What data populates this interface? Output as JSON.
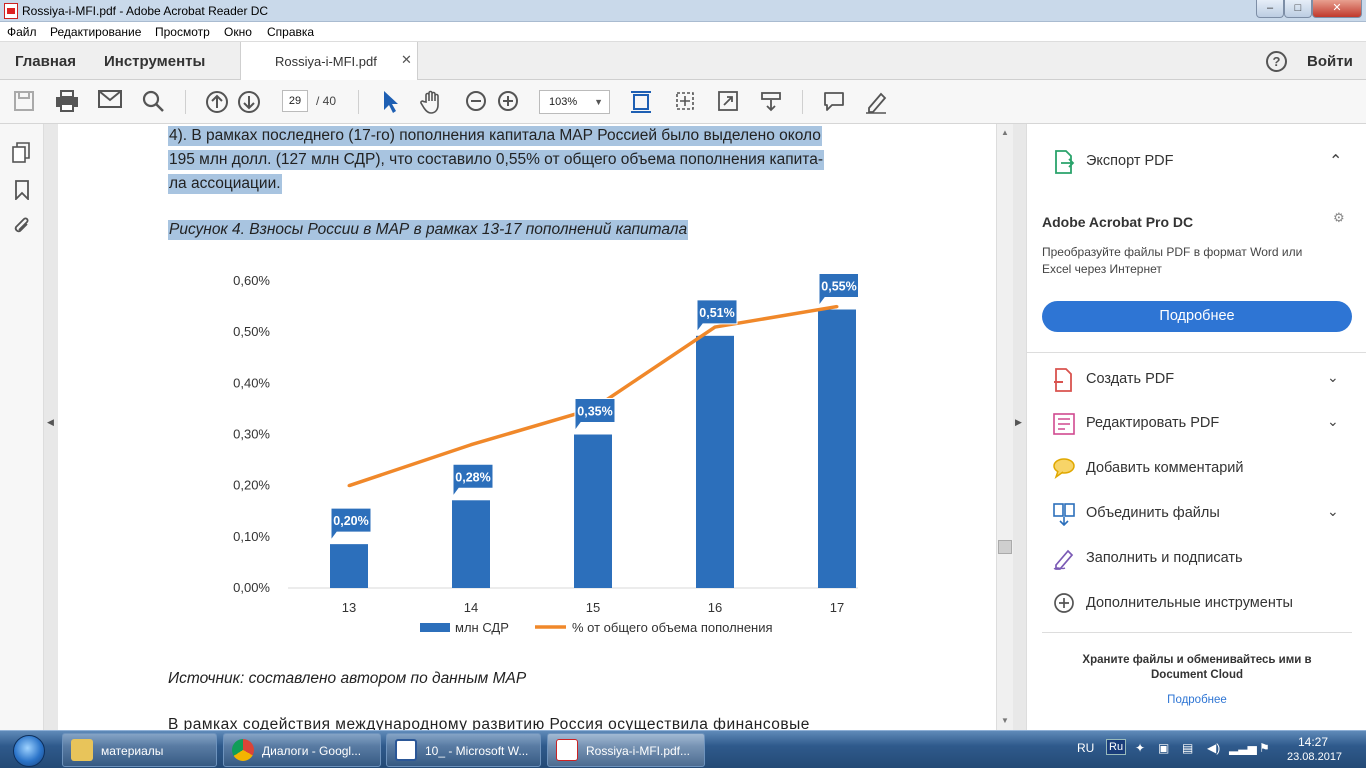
{
  "window": {
    "title": "Rossiya-i-MFI.pdf - Adobe Acrobat Reader DC",
    "min": "–",
    "max": "□",
    "close": "✕"
  },
  "menu": [
    "Файл",
    "Редактирование",
    "Просмотр",
    "Окно",
    "Справка"
  ],
  "tabs": {
    "home": "Главная",
    "tools": "Инструменты",
    "doc": "Rossiya-i-MFI.pdf",
    "close": "✕",
    "help": "?",
    "signin": "Войти"
  },
  "toolbar": {
    "page_current": "29",
    "page_total": "/ 40",
    "zoom": "103%"
  },
  "document": {
    "para_lines": [
      "4). В рамках последнего (17-го) пополнения капитала МАР Россией было выделено около",
      "195 млн долл. (127 млн СДР), что составило 0,55% от общего объема пополнения капита-",
      "ла ассоциации."
    ],
    "figure_caption": "Рисунок 4. Взносы России в МАР в рамках 13-17 пополнений капитала",
    "source": "Источник: составлено автором по данным МАР",
    "next_para": "В рамках содействия международному развитию Россия осуществила финансовые"
  },
  "chart_data": {
    "type": "bar",
    "categories": [
      "13",
      "14",
      "15",
      "16",
      "17"
    ],
    "series": [
      {
        "name": "млн СДР",
        "kind": "bar",
        "axis": "right",
        "color": "#2c6fbb",
        "values": [
          20,
          40,
          70,
          115,
          127
        ]
      },
      {
        "name": "% от общего объема пополнения",
        "kind": "line",
        "axis": "left",
        "color": "#f0882a",
        "values": [
          0.2,
          0.28,
          0.35,
          0.51,
          0.55
        ]
      }
    ],
    "data_labels": [
      "0,20%",
      "0,28%",
      "0,35%",
      "0,51%",
      "0,55%"
    ],
    "y_left": {
      "ticks": [
        "0,00%",
        "0,10%",
        "0,20%",
        "0,30%",
        "0,40%",
        "0,50%",
        "0,60%"
      ],
      "lim": [
        0,
        0.6
      ]
    },
    "y_right": {
      "ticks": [
        "0",
        "20",
        "40",
        "60",
        "80",
        "100",
        "120",
        "140"
      ],
      "lim": [
        0,
        140
      ]
    },
    "legend": "bottom"
  },
  "right_panel": {
    "export": "Экспорт PDF",
    "promo_title": "Adobe Acrobat Pro DC",
    "promo_text_1": "Преобразуйте файлы PDF в формат Word или",
    "promo_text_2": "Excel через Интернет",
    "promo_button": "Подробнее",
    "tools": [
      {
        "label": "Создать PDF",
        "icon": "create-pdf-icon",
        "color": "#d9534f"
      },
      {
        "label": "Редактировать PDF",
        "icon": "edit-pdf-icon",
        "color": "#d04a8f"
      },
      {
        "label": "Добавить комментарий",
        "icon": "comment-icon",
        "color": "#f2b705"
      },
      {
        "label": "Объединить файлы",
        "icon": "combine-files-icon",
        "color": "#2c6fbb"
      },
      {
        "label": "Заполнить и подписать",
        "icon": "fill-sign-icon",
        "color": "#7b5ab5"
      },
      {
        "label": "Дополнительные инструменты",
        "icon": "more-tools-icon",
        "color": "#555555"
      }
    ],
    "cloud_1": "Храните файлы и обменивайтесь ими в",
    "cloud_2": "Document Cloud",
    "cloud_link": "Подробнее"
  },
  "taskbar": {
    "items": [
      "материалы",
      "Диалоги - Googl...",
      "10_ - Microsoft W...",
      "Rossiya-i-MFI.pdf..."
    ],
    "lang": "RU",
    "ime": "Ru",
    "time": "14:27",
    "date": "23.08.2017"
  }
}
